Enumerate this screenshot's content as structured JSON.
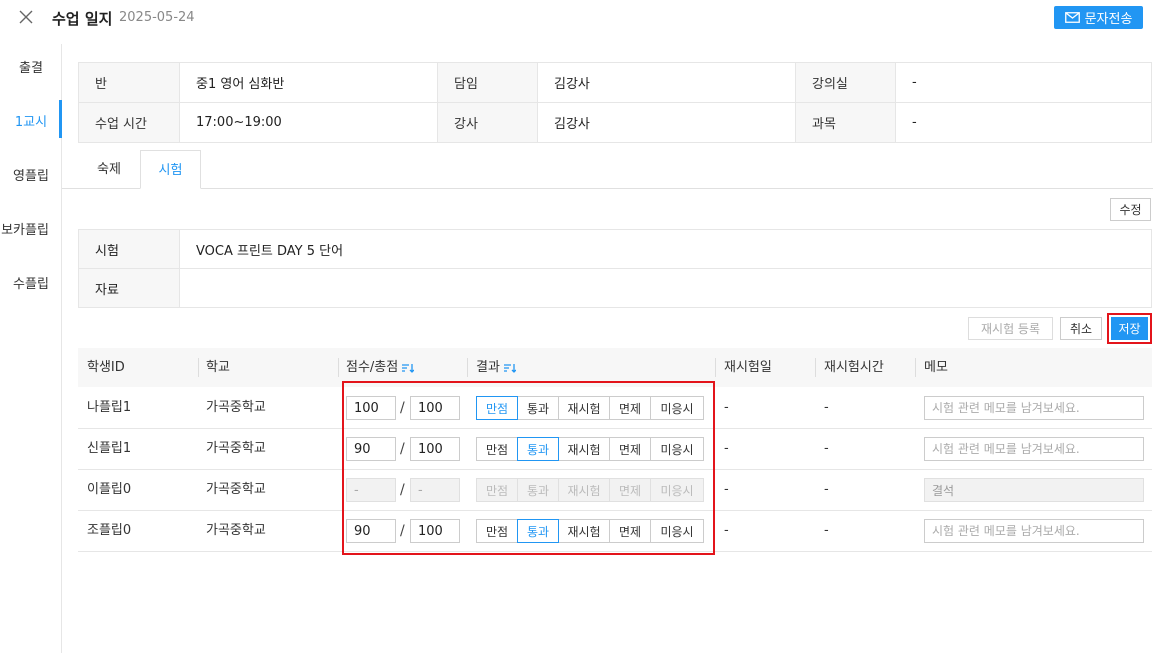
{
  "header": {
    "title": "수업 일지",
    "date": "2025-05-24",
    "sms_label": "문자전송",
    "close_icon": "close-icon",
    "mail_icon": "mail-icon"
  },
  "sidebar": {
    "items": [
      {
        "label": "출결",
        "active": false
      },
      {
        "label": "1교시",
        "active": true
      },
      {
        "label": "영플립",
        "active": false
      },
      {
        "label": "보카플립",
        "active": false
      },
      {
        "label": "수플립",
        "active": false
      }
    ]
  },
  "class_info": {
    "class_label": "반",
    "class_value": "중1 영어 심화반",
    "homeroom_label": "담임",
    "homeroom_value": "김강사",
    "room_label": "강의실",
    "room_value": "-",
    "time_label": "수업 시간",
    "time_value": "17:00~19:00",
    "teacher_label": "강사",
    "teacher_value": "김강사",
    "subject_label": "과목",
    "subject_value": "-"
  },
  "tabs": [
    {
      "label": "숙제",
      "active": false
    },
    {
      "label": "시험",
      "active": true
    }
  ],
  "test": {
    "edit_label": "수정",
    "test_label": "시험",
    "test_value": "VOCA 프린트 DAY 5 단어",
    "material_label": "자료",
    "material_value": ""
  },
  "actions": {
    "retest_label": "재시험 등록",
    "cancel_label": "취소",
    "save_label": "저장"
  },
  "grid": {
    "columns": {
      "student_id": "학생ID",
      "school": "학교",
      "score": "점수/총점",
      "result": "결과",
      "retest_date": "재시험일",
      "retest_time": "재시험시간",
      "memo": "메모"
    },
    "slash": "/",
    "result_options": [
      "만점",
      "통과",
      "재시험",
      "면제",
      "미응시"
    ],
    "memo_placeholder": "시험 관련 메모를 남겨보세요.",
    "rows": [
      {
        "student_id": "나플립1",
        "school": "가곡중학교",
        "score": "100",
        "total": "100",
        "result": "만점",
        "disabled": false,
        "retest_date": "-",
        "retest_time": "-",
        "memo": ""
      },
      {
        "student_id": "신플립1",
        "school": "가곡중학교",
        "score": "90",
        "total": "100",
        "result": "통과",
        "disabled": false,
        "retest_date": "-",
        "retest_time": "-",
        "memo": ""
      },
      {
        "student_id": "이플립0",
        "school": "가곡중학교",
        "score": "-",
        "total": "-",
        "result": "",
        "disabled": true,
        "retest_date": "-",
        "retest_time": "-",
        "memo": "결석"
      },
      {
        "student_id": "조플립0",
        "school": "가곡중학교",
        "score": "90",
        "total": "100",
        "result": "통과",
        "disabled": false,
        "retest_date": "-",
        "retest_time": "-",
        "memo": ""
      }
    ]
  },
  "colors": {
    "accent": "#2196f3",
    "highlight": "#e3141b"
  }
}
